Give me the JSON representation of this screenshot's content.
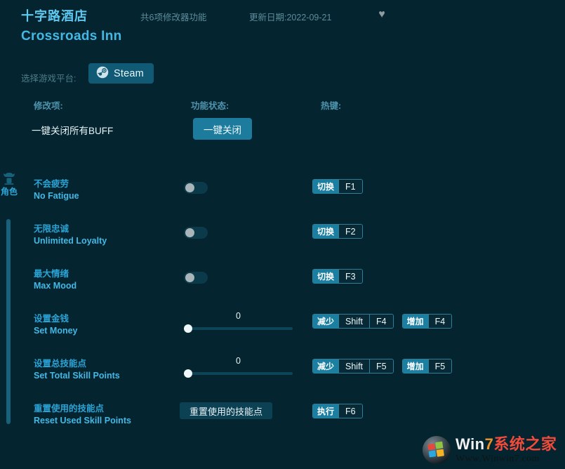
{
  "header": {
    "title_cn": "十字路酒店",
    "title_en": "Crossroads Inn",
    "feature_count": "共6项修改器功能",
    "update_date": "更新日期:2022-09-21",
    "favorite_icon": "heart-icon"
  },
  "platform": {
    "label": "选择游戏平台:",
    "selected": "Steam",
    "icon": "steam-icon"
  },
  "columns": {
    "option": "修改项:",
    "status": "功能状态:",
    "hotkey": "热键:"
  },
  "oneclick": {
    "label": "一键关闭所有BUFF",
    "button": "一键关闭"
  },
  "category": {
    "icon": "character-icon",
    "name": "角色"
  },
  "rows": [
    {
      "cn": "不会疲劳",
      "en": "No Fatigue",
      "control": "toggle",
      "toggle_on": false,
      "hotkeys": [
        {
          "action": "切换",
          "keys": [
            "F1"
          ]
        }
      ]
    },
    {
      "cn": "无限忠诚",
      "en": "Unlimited Loyalty",
      "control": "toggle",
      "toggle_on": false,
      "hotkeys": [
        {
          "action": "切换",
          "keys": [
            "F2"
          ]
        }
      ]
    },
    {
      "cn": "最大情绪",
      "en": "Max Mood",
      "control": "toggle",
      "toggle_on": false,
      "hotkeys": [
        {
          "action": "切换",
          "keys": [
            "F3"
          ]
        }
      ]
    },
    {
      "cn": "设置金钱",
      "en": "Set Money",
      "control": "slider",
      "value": "0",
      "hotkeys": [
        {
          "action": "减少",
          "keys": [
            "Shift",
            "F4"
          ]
        },
        {
          "action": "增加",
          "keys": [
            "F4"
          ]
        }
      ]
    },
    {
      "cn": "设置总技能点",
      "en": "Set Total Skill Points",
      "control": "slider",
      "value": "0",
      "hotkeys": [
        {
          "action": "减少",
          "keys": [
            "Shift",
            "F5"
          ]
        },
        {
          "action": "增加",
          "keys": [
            "F5"
          ]
        }
      ]
    },
    {
      "cn": "重置使用的技能点",
      "en": "Reset Used Skill Points",
      "control": "action",
      "action_label": "重置使用的技能点",
      "hotkeys": [
        {
          "action": "执行",
          "keys": [
            "F6"
          ]
        }
      ]
    }
  ],
  "watermark": {
    "main_1": "Win",
    "main_2": "7",
    "main_3": "系统之家",
    "sub": "Www.Winwin7.com",
    "icon": "windows-orb-icon"
  },
  "colors": {
    "background": "#04252f",
    "accent": "#2ba3d6",
    "accent_bright": "#43b8e6",
    "button_teal": "#1d7c9e",
    "platform_teal": "#105a75"
  }
}
